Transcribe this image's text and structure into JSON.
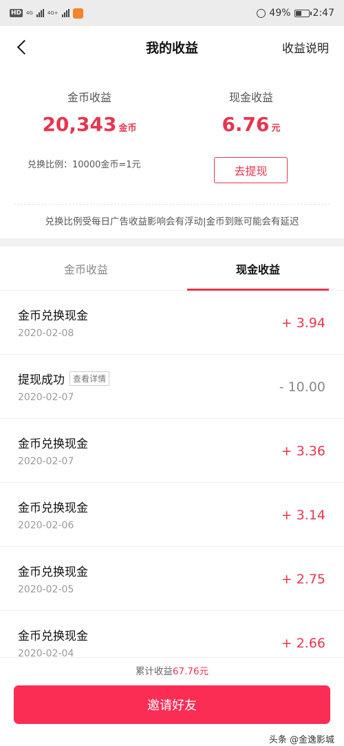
{
  "status_bar": {
    "hd": "HD",
    "net1": "4G",
    "net2": "4G+",
    "battery": "49%",
    "time": "2:47",
    "battery_level": 0.49
  },
  "header": {
    "title": "我的收益",
    "right_link": "收益说明"
  },
  "summary": {
    "coins_label": "金币收益",
    "coins_value": "20,343",
    "coins_unit": "金币",
    "cash_label": "现金收益",
    "cash_value": "6.76",
    "cash_unit": "元",
    "ratio_text": "兑换比例：10000金币=1元",
    "withdraw_label": "去提现",
    "notice": "兑换比例受每日广告收益影响会有浮动|金币到账可能会有延迟",
    "accent_color": "#e8344e"
  },
  "tabs": {
    "coins": "金币收益",
    "cash": "现金收益",
    "active": "cash"
  },
  "records": [
    {
      "title": "金币兑换现金",
      "date": "2020-02-08",
      "amount": "+ 3.94",
      "positive": true
    },
    {
      "title": "提现成功",
      "tag": "查看详情",
      "date": "2020-02-07",
      "amount": "- 10.00",
      "positive": false
    },
    {
      "title": "金币兑换现金",
      "date": "2020-02-07",
      "amount": "+ 3.36",
      "positive": true
    },
    {
      "title": "金币兑换现金",
      "date": "2020-02-06",
      "amount": "+ 3.14",
      "positive": true
    },
    {
      "title": "金币兑换现金",
      "date": "2020-02-05",
      "amount": "+ 2.75",
      "positive": true
    },
    {
      "title": "金币兑换现金",
      "date": "2020-02-04",
      "amount": "+ 2.66",
      "positive": true
    }
  ],
  "footer": {
    "total_label": "累计收益",
    "total_value": "67.76元",
    "invite_label": "邀请好友",
    "invite_color": "#fb2d55"
  },
  "watermark": "头条 @金逸影城"
}
